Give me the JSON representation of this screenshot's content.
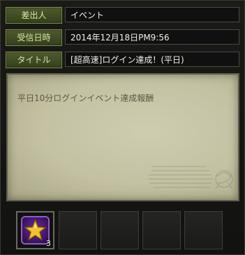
{
  "mail": {
    "fields": [
      {
        "label": "差出人",
        "value": "イベント"
      },
      {
        "label": "受信日時",
        "value": "2014年12月18日PM9:56"
      },
      {
        "label": "タイトル",
        "value": "[超高速]ログイン達成！(平日)"
      }
    ],
    "body": "平日10分ログインイベント達成報酬",
    "attachments": [
      {
        "icon": "gold-star-icon",
        "count": "3"
      }
    ]
  },
  "colors": {
    "label_bg": "#4e5b2f",
    "label_text": "#d9e8a6",
    "parchment": "#c8c6a8",
    "item_bg": "#4a1f78",
    "star": "#f2c230"
  }
}
